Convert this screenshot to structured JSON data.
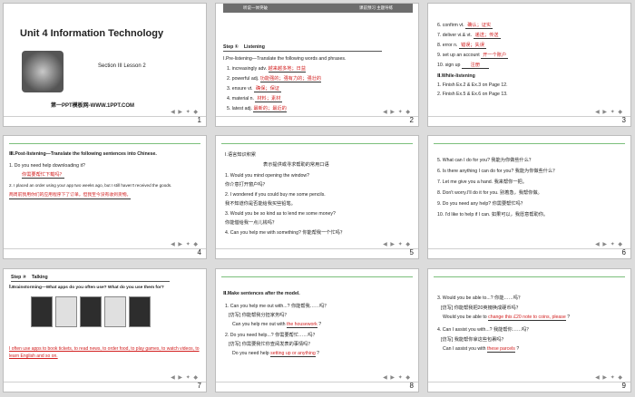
{
  "slides": [
    {
      "number": "1",
      "title": "Unit 4   Information Technology",
      "section": "Section III    Lesson 2",
      "footer": "第一PPT模板网-WWW.1PPT.COM"
    },
    {
      "number": "2",
      "header": "听说一体突破",
      "header_right": "课前预习  主题导练",
      "step": "Step ①",
      "step_label": "Listening",
      "intro": "Ⅰ.Pre-listening—Translate the following words and phrases.",
      "items": [
        {
          "n": "1.",
          "term": "increasingly adv.",
          "ans": "越来越多地；日益"
        },
        {
          "n": "2.",
          "term": "powerful  adj.",
          "ans": "功能强的；强有力的；强壮的"
        },
        {
          "n": "3.",
          "term": "ensure  vt.",
          "ans": "确保；保证"
        },
        {
          "n": "4.",
          "term": "material  n.",
          "ans": "材料；素材"
        },
        {
          "n": "5.",
          "term": "latest adj.",
          "ans": "最新的；最近的"
        }
      ]
    },
    {
      "number": "3",
      "items": [
        {
          "n": "6.",
          "term": "confirm  vt.",
          "ans": "确认；证实"
        },
        {
          "n": "7.",
          "term": "deliver vi.& vt.",
          "ans": "递送；传送"
        },
        {
          "n": "8.",
          "term": "error  n.",
          "ans": "错误；失误"
        },
        {
          "n": "9.",
          "term": "set up an account",
          "ans": "开一个账户"
        },
        {
          "n": "10.",
          "term": "sign up",
          "ans": "注册"
        }
      ],
      "section": "Ⅱ.While-listening",
      "lines": [
        "1.  Finish Ex.2 & Ex.3 on Page 12.",
        "2.  Finish Ex.5 & Ex.6 on Page 13."
      ]
    },
    {
      "number": "4",
      "intro": "Ⅲ.Post-listening—Translate the following sentences  into Chinese.",
      "q1": "1.   Do you need help downloading it?",
      "a1": "你需要帮忙下载吗？",
      "q2": "2.   I placed an order using your app two weeks  ago, but I still haven't received  the goods.",
      "a2": "两周前我用你们的应用程序下了订单，但我至今没有收到货物。"
    },
    {
      "number": "5",
      "section": "Ⅰ.语言知识积累",
      "subtitle": "表示提供或寻求帮助的常用口语",
      "lines": [
        "1.   Would you mind opening the window?",
        "你介意打开窗户吗？",
        "2.   I wondered  if you could buy me some pencils.",
        "我不知道你是否能给我买些铅笔。",
        "3.   Would you be so kind as to lend me some money?",
        "你能借给我一点儿钱吗？",
        "4.   Can you help me with something?  你能帮我一个忙吗？"
      ]
    },
    {
      "number": "6",
      "lines": [
        "5.   What can I do for you?  我能为你做些什么？",
        "6.   Is there anything I can do for  you?  我能为你做些什么？",
        "7.   Let me give you a hand. 我来帮你一把。",
        "8.   Don't worry.I'll do it for  you. 别着急，我帮你做。",
        "9.   Do you need any help? 你需要帮忙吗？",
        "10.  I'd like to help if I can. 如果可以，我愿意帮助你。"
      ]
    },
    {
      "number": "7",
      "step": "Step ②",
      "step_label": "Talking",
      "intro": "Ⅰ.Brainstorming—What apps do you often use?  What do you use them for?",
      "answer": "I often use apps to book tickets, to read news, to order food, to play games, to watch videos, to learn English and so on."
    },
    {
      "number": "8",
      "section": "Ⅱ.Make sentences after the model.",
      "lines": [
        "1.   Can you help me out with...?  你能帮我……吗？",
        "[仿写]    你能帮我分担家务吗？",
        "2.   Do you need help...?  你需要帮忙……吗？",
        "[仿写]    你需要我忙你查阅发表的事情吗？"
      ],
      "fill1_pre": "Can you help me out with",
      "fill1": "the housework",
      "fill2_pre": "Do you need help",
      "fill2": "setting up or anything"
    },
    {
      "number": "9",
      "lines": [
        "3.   Would you be able to...?  你能……吗？",
        "[仿写]    你能帮我把20英镑换成硬币吗？",
        "4.   Can I assist you with...?  我能帮你……吗？",
        "[仿写]    我能帮你拿这些包裹吗？"
      ],
      "fill1_pre": "Would you be able to",
      "fill1": "change this £20 note to coins, please",
      "fill2_pre": "Can I assist you with",
      "fill2": "these parcels"
    }
  ]
}
